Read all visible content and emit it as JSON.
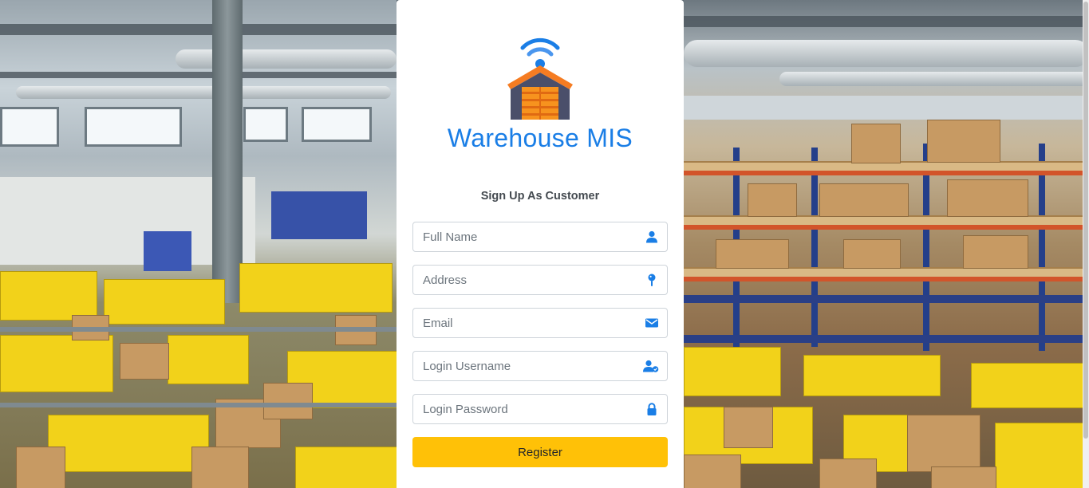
{
  "app": {
    "title": "Warehouse MIS"
  },
  "form": {
    "heading": "Sign Up As Customer",
    "fields": [
      {
        "placeholder": "Full Name",
        "value": "",
        "icon": "user-icon"
      },
      {
        "placeholder": "Address",
        "value": "",
        "icon": "map-pin-icon"
      },
      {
        "placeholder": "Email",
        "value": "",
        "icon": "envelope-icon"
      },
      {
        "placeholder": "Login Username",
        "value": "",
        "icon": "user-check-icon"
      },
      {
        "placeholder": "Login Password",
        "value": "",
        "icon": "lock-icon"
      }
    ],
    "submit_label": "Register"
  },
  "colors": {
    "brand": "#1a7ee6",
    "icon": "#1a7ee6",
    "button": "#ffc107",
    "logo_roof": "#f57c22",
    "logo_door": "#f7931e",
    "logo_wall": "#4a4f6a"
  }
}
